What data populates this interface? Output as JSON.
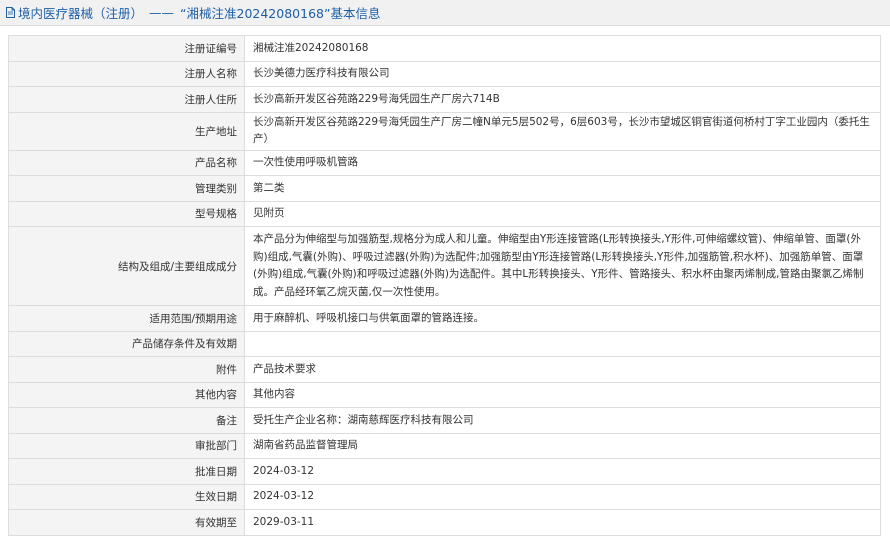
{
  "header": {
    "icon": "document-icon",
    "category": "境内医疗器械（注册）",
    "separator": "——",
    "title": "“湘械注准20242080168”基本信息"
  },
  "rows": [
    {
      "label": "注册证编号",
      "value": "湘械注准20242080168"
    },
    {
      "label": "注册人名称",
      "value": "长沙美德力医疗科技有限公司"
    },
    {
      "label": "注册人住所",
      "value": "长沙高新开发区谷苑路229号海凭园生产厂房六714B"
    },
    {
      "label": "生产地址",
      "value": "长沙高新开发区谷苑路229号海凭园生产厂房二幢N单元5层502号，6层603号，长沙市望城区铜官街道何桥村丁字工业园内（委托生产）"
    },
    {
      "label": "产品名称",
      "value": "一次性使用呼吸机管路"
    },
    {
      "label": "管理类别",
      "value": "第二类"
    },
    {
      "label": "型号规格",
      "value": "见附页"
    },
    {
      "label": "结构及组成/主要组成成分",
      "value": "本产品分为伸缩型与加强筋型,规格分为成人和儿童。伸缩型由Y形连接管路(L形转换接头,Y形件,可伸缩螺纹管)、伸缩单管、面罩(外购)组成,气囊(外购)、呼吸过滤器(外购)为选配件;加强筋型由Y形连接管路(L形转换接头,Y形件,加强筋管,积水杯)、加强筋单管、面罩(外购)组成,气囊(外购)和呼吸过滤器(外购)为选配件。其中L形转换接头、Y形件、管路接头、积水杯由聚丙烯制成,管路由聚氯乙烯制成。产品经环氧乙烷灭菌,仅一次性使用。"
    },
    {
      "label": "适用范围/预期用途",
      "value": "用于麻醉机、呼吸机接口与供氧面罩的管路连接。"
    },
    {
      "label": "产品储存条件及有效期",
      "value": ""
    },
    {
      "label": "附件",
      "value": "产品技术要求"
    },
    {
      "label": "其他内容",
      "value": "其他内容"
    },
    {
      "label": "备注",
      "value": "受托生产企业名称：湖南慈辉医疗科技有限公司"
    },
    {
      "label": "审批部门",
      "value": "湖南省药品监督管理局"
    },
    {
      "label": "批准日期",
      "value": "2024-03-12"
    },
    {
      "label": "生效日期",
      "value": "2024-03-12"
    },
    {
      "label": "有效期至",
      "value": "2029-03-11"
    }
  ]
}
